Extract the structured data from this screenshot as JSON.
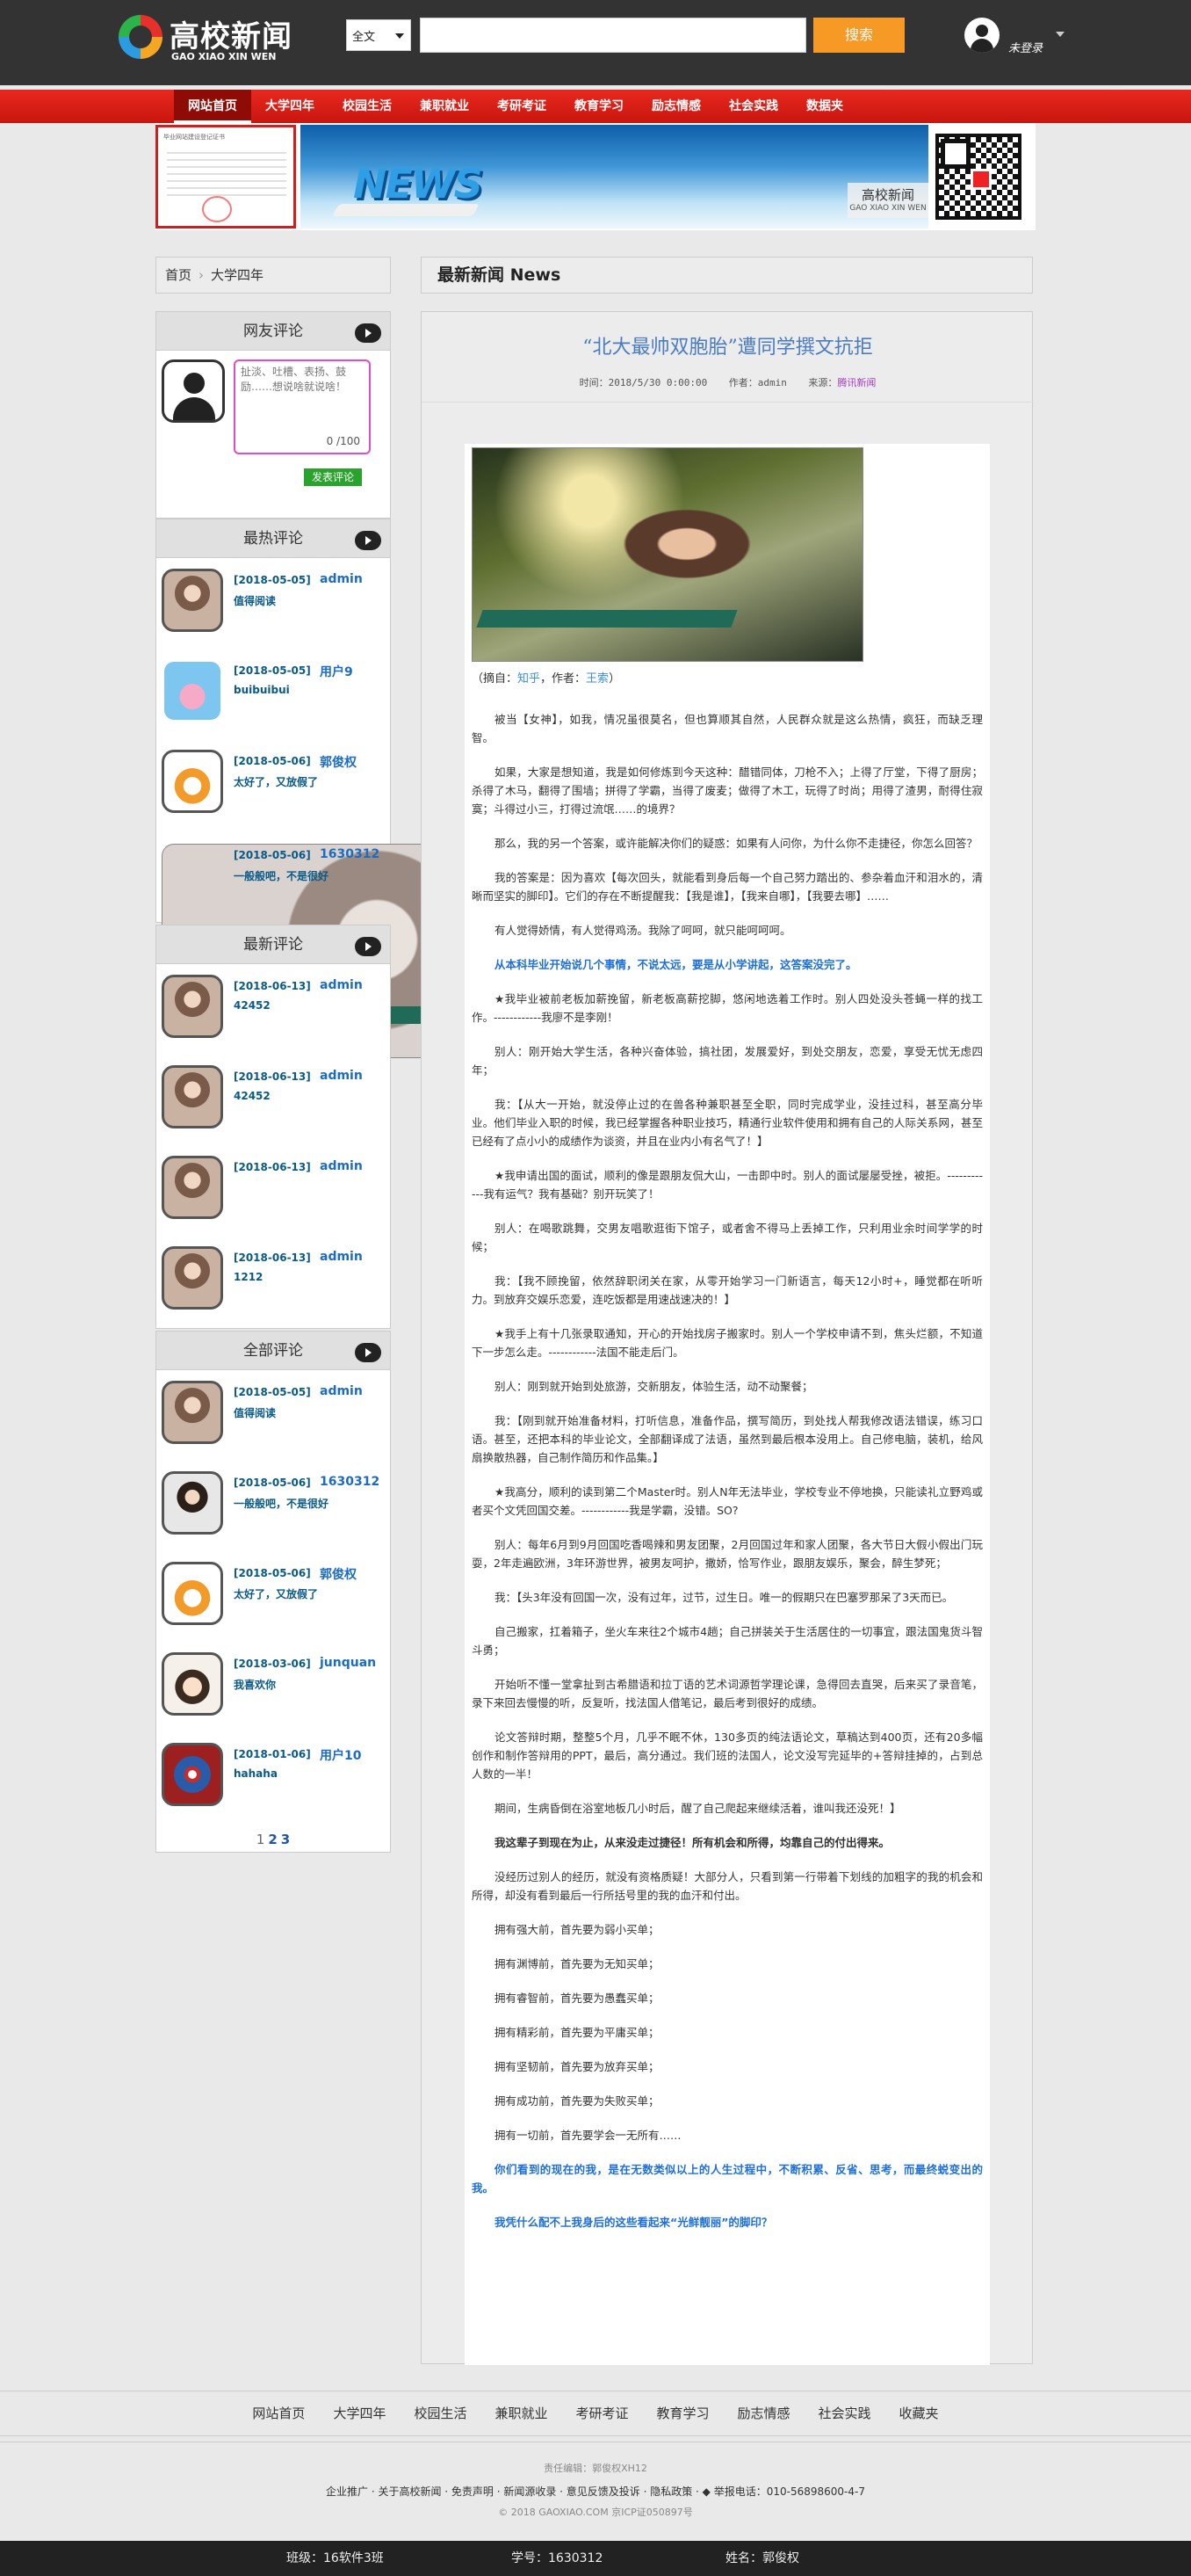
{
  "header": {
    "logo_cn": "高校新闻",
    "logo_en": "GAO XIAO XIN WEN",
    "search_scope": "全文",
    "search_value": "",
    "search_button": "搜索",
    "user_status": "未登录"
  },
  "nav": [
    "网站首页",
    "大学四年",
    "校园生活",
    "兼职就业",
    "考研考证",
    "教育学习",
    "励志情感",
    "社会实践",
    "数据夹"
  ],
  "banner": {
    "cert_text": "毕业网站建设登记证书",
    "tag_cn": "高校新闻",
    "tag_en": "GAO XIAO XIN WEN",
    "news_word": "NEWS"
  },
  "breadcrumb": {
    "home": "首页",
    "current": "大学四年"
  },
  "sidebar": {
    "friend_title": "网友评论",
    "textarea_placeholder": "扯淡、吐槽、表扬、鼓励……想说啥就说啥！",
    "counter": "0   /100",
    "submit": "发表评论",
    "hot_title": "最热评论",
    "hot": [
      {
        "date": "[2018-05-05]",
        "user": "admin",
        "text": "值得阅读",
        "av": "girl"
      },
      {
        "date": "[2018-05-05]",
        "user": "用户9",
        "text": "buibuibui",
        "av": "pig"
      },
      {
        "date": "[2018-05-06]",
        "user": "郭俊权",
        "text": "太好了，又放假了",
        "av": "boy"
      },
      {
        "date": "[2018-05-06]",
        "user": "1630312",
        "text": "一般般吧，不是很好",
        "av": "photo"
      }
    ],
    "latest_title": "最新评论",
    "latest": [
      {
        "date": "[2018-06-13]",
        "user": "admin",
        "text": "42452",
        "av": "girl"
      },
      {
        "date": "[2018-06-13]",
        "user": "admin",
        "text": "42452",
        "av": "girl"
      },
      {
        "date": "[2018-06-13]",
        "user": "admin",
        "text": "",
        "av": "girl"
      },
      {
        "date": "[2018-06-13]",
        "user": "admin",
        "text": "1212",
        "av": "girl"
      }
    ],
    "all_title": "全部评论",
    "all": [
      {
        "date": "[2018-05-05]",
        "user": "admin",
        "text": "值得阅读",
        "av": "girl"
      },
      {
        "date": "[2018-05-06]",
        "user": "1630312",
        "text": "一般般吧，不是很好",
        "av": "guy"
      },
      {
        "date": "[2018-05-06]",
        "user": "郭俊权",
        "text": "太好了，又放假了",
        "av": "boy"
      },
      {
        "date": "[2018-03-06]",
        "user": "junquan",
        "text": "我喜欢你",
        "av": "kid"
      },
      {
        "date": "[2018-01-06]",
        "user": "用户10",
        "text": "hahaha",
        "av": "cap"
      }
    ],
    "pages": [
      "1",
      "2",
      "3"
    ]
  },
  "main": {
    "heading": "最新新闻 News",
    "title": "“北大最帅双胞胎”遭同学撰文抗拒",
    "time_label": "时间：",
    "time": "2018/5/30 0:00:00",
    "author_label": "作者：",
    "author": "admin",
    "source_label": "来源：",
    "source": "腾讯新闻",
    "caption_pre": "（摘自：",
    "caption_src": "知乎",
    "caption_mid": "，作者：",
    "caption_author": "王索",
    "caption_post": "）",
    "paragraphs": [
      {
        "s": "",
        "t": "被当【女神】，如我，情况虽很莫名，但也算顺其自然，人民群众就是这么热情，疯狂，而缺乏理智。"
      },
      {
        "s": "",
        "t": "如果，大家是想知道，我是如何修炼到今天这种：醋错同体，刀枪不入；上得了厅堂，下得了厨房；杀得了木马，翻得了围墙；拼得了学霸，当得了废麦；做得了木工，玩得了时尚；用得了渣男，耐得住寂寞；斗得过小三，打得过流氓……的境界？"
      },
      {
        "s": "",
        "t": "那么，我的另一个答案，或许能解决你们的疑惑：如果有人问你，为什么你不走捷径，你怎么回答？"
      },
      {
        "s": "",
        "t": "我的答案是：因为喜欢【每次回头，就能看到身后每一个自己努力踏出的、参杂着血汗和泪水的，清晰而坚实的脚印】。它们的存在不断提醒我：【我是谁】，【我来自哪】，【我要去哪】……"
      },
      {
        "s": "",
        "t": "有人觉得娇情，有人觉得鸡汤。我除了呵呵，就只能呵呵呵。"
      },
      {
        "s": "blue",
        "t": "从本科毕业开始说几个事情，不说太远，要是从小学讲起，这答案没完了。"
      },
      {
        "s": "",
        "t": "★我毕业被前老板加薪挽留，新老板高薪挖脚，悠闲地选着工作时。别人四处没头苍蝇一样的找工作。------------我廖不是李刚！"
      },
      {
        "s": "",
        "t": "别人：刚开始大学生活，各种兴奋体验，搞社团，发展爱好，到处交朋友，恋爱，享受无忧无虑四年；"
      },
      {
        "s": "",
        "t": "我：【从大一开始，就没停止过的在兽各种兼职甚至全职，同时完成学业，没挂过科，甚至高分毕业。他们毕业入职的时候，我已经掌握各种职业技巧，精通行业软件使用和拥有自己的人际关系网，甚至已经有了点小小的成绩作为谈资，并且在业内小有名气了！】"
      },
      {
        "s": "",
        "t": "★我申请出国的面试，顺利的像是跟朋友侃大山，一击即中时。别人的面试屡屡受挫，被拒。------------我有运气？我有基础？别开玩笑了！"
      },
      {
        "s": "",
        "t": "别人：在喝歌跳舞，交男友唱歌逛街下馆子，或者舍不得马上丢掉工作，只利用业余时间学学的时候；"
      },
      {
        "s": "",
        "t": "我：【我不顾挽留，依然辞职闭关在家，从零开始学习一门新语言，每天12小时+，睡觉都在听听力。到放弃交娱乐恋爱，连吃饭都是用速战速决的！】"
      },
      {
        "s": "",
        "t": "★我手上有十几张录取通知，开心的开始找房子搬家时。别人一个学校申请不到，焦头烂额，不知道下一步怎么走。------------法国不能走后门。"
      },
      {
        "s": "",
        "t": "别人：刚到就开始到处旅游，交新朋友，体验生活，动不动聚餐；"
      },
      {
        "s": "",
        "t": "我：【刚到就开始准备材料，打听信息，准备作品，撰写简历，到处找人帮我修改语法错误，练习口语。甚至，还把本科的毕业论文，全部翻译成了法语，虽然到最后根本没用上。自己修电脑，装机，给风扇换散热器，自己制作简历和作品集。】"
      },
      {
        "s": "",
        "t": "★我高分，顺利的读到第二个Master时。别人N年无法毕业，学校专业不停地换，只能读礼立野鸡或者买个文凭回国交差。------------我是学霸，没错。SO?"
      },
      {
        "s": "",
        "t": "别人：每年6月到9月回国吃香喝辣和男友团聚，2月回国过年和家人团聚，各大节日大假小假出门玩耍，2年走遍欧洲，3年环游世界，被男友呵护，撒娇，恰写作业，跟朋友娱乐，聚会，醉生梦死；"
      },
      {
        "s": "",
        "t": "我：【头3年没有回国一次，没有过年，过节，过生日。唯一的假期只在巴塞罗那呆了3天而已。"
      },
      {
        "s": "",
        "t": "自己搬家，扛着箱子，坐火车来往2个城市4趟；自己拼装关于生活居住的一切事宜，跟法国鬼货斗智斗勇；"
      },
      {
        "s": "",
        "t": "开始听不懂一堂拿扯到古希腊语和拉丁语的艺术词源哲学理论课，急得回去直哭，后来买了录音笔，录下来回去慢慢的听，反复听，找法国人借笔记，最后考到很好的成绩。"
      },
      {
        "s": "",
        "t": "论文答辩时期，整整5个月，几乎不眠不休，130多页的纯法语论文，草稿达到400页，还有20多幅创作和制作答辩用的PPT，最后，高分通过。我们班的法国人，论文没写完延毕的+答辩挂掉的，占到总人数的一半！"
      },
      {
        "s": "",
        "t": "期间，生病昏倒在浴室地板几小时后，醒了自己爬起来继续活着，谁叫我还没死！】"
      },
      {
        "s": "b",
        "t": "我这辈子到现在为止，从来没走过捷径！所有机会和所得，均靠自己的付出得来。"
      },
      {
        "s": "",
        "t": "没经历过别人的经历，就没有资格质疑！大部分人，只看到第一行带着下划线的加粗字的我的机会和所得，却没有看到最后一行所括号里的我的血汗和付出。"
      },
      {
        "s": "",
        "t": "拥有强大前，首先要为弱小买单；"
      },
      {
        "s": "",
        "t": "拥有渊博前，首先要为无知买单；"
      },
      {
        "s": "",
        "t": "拥有睿智前，首先要为愚蠢买单；"
      },
      {
        "s": "",
        "t": "拥有精彩前，首先要为平庸买单；"
      },
      {
        "s": "",
        "t": "拥有坚韧前，首先要为放弃买单；"
      },
      {
        "s": "",
        "t": "拥有成功前，首先要为失败买单；"
      },
      {
        "s": "",
        "t": "拥有一切前，首先要学会一无所有……"
      },
      {
        "s": "blue",
        "t": "你们看到的现在的我，是在无数类似以上的人生过程中，不断积累、反省、思考，而最终蜕变出的我。"
      },
      {
        "s": "blue",
        "t": "我凭什么配不上我身后的这些看起来“光鲜靓丽”的脚印？"
      }
    ]
  },
  "footer": {
    "nav": [
      "网站首页",
      "大学四年",
      "校园生活",
      "兼职就业",
      "考研考证",
      "教育学习",
      "励志情感",
      "社会实践",
      "收藏夹"
    ],
    "editor": "责任编辑：郭俊权XH12",
    "links": "企业推广 · 关于高校新闻 · 免责声明 · 新闻源收录 · 意见反馈及投诉 · 隐私政策 · ◆ 举报电话：010-56898600-4-7",
    "copyright": "© 2018 GAOXIAO.COM 京ICP证050897号",
    "class_label": "班级：16软件3班",
    "id_label": "学号：1630312",
    "name_label": "姓名：郭俊权"
  }
}
